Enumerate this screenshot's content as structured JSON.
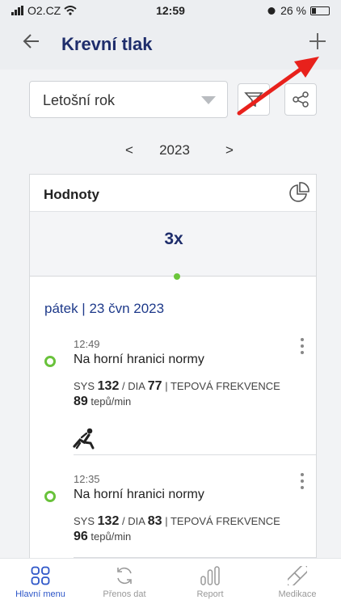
{
  "status_bar": {
    "carrier": "O2.CZ",
    "time": "12:59",
    "battery": "26 %",
    "battery_level": 0.26
  },
  "header": {
    "title": "Krevní tlak",
    "back_icon": "arrow-left-icon",
    "add_icon": "plus-icon"
  },
  "filter": {
    "period": "Letošní rok",
    "filter_icon": "filter-icon",
    "share_icon": "share-icon"
  },
  "year_nav": {
    "prev": "<",
    "year": "2023",
    "next": ">"
  },
  "card": {
    "title": "Hodnoty",
    "chart_icon": "pie-chart-icon",
    "count": "3x",
    "day": "pátek | 23 čvn 2023",
    "entries": [
      {
        "time": "12:49",
        "status": "Na horní hranici normy",
        "sys_label": "SYS",
        "sys": "132",
        "dia_label": "DIA",
        "dia": "77",
        "pulse_label": "TEPOVÁ FREKVENCE",
        "pulse": "89",
        "pulse_unit": "tepů/min",
        "position_icon": "reclining-person-icon"
      },
      {
        "time": "12:35",
        "status": "Na horní hranici normy",
        "sys_label": "SYS",
        "sys": "132",
        "dia_label": "DIA",
        "dia": "83",
        "pulse_label": "TEPOVÁ FREKVENCE",
        "pulse": "96",
        "pulse_unit": "tepů/min"
      }
    ]
  },
  "tabs": [
    {
      "label": "Hlavní menu",
      "icon": "grid-icon",
      "active": true
    },
    {
      "label": "Přenos dat",
      "icon": "sync-icon",
      "active": false
    },
    {
      "label": "Report",
      "icon": "bar-chart-icon",
      "active": false
    },
    {
      "label": "Medikace",
      "icon": "pill-icon",
      "active": false
    }
  ],
  "colors": {
    "accent": "#1e2d6b",
    "status_ok": "#69c23b",
    "tab_active": "#2d56c8",
    "annotation_arrow": "#e8211c"
  }
}
